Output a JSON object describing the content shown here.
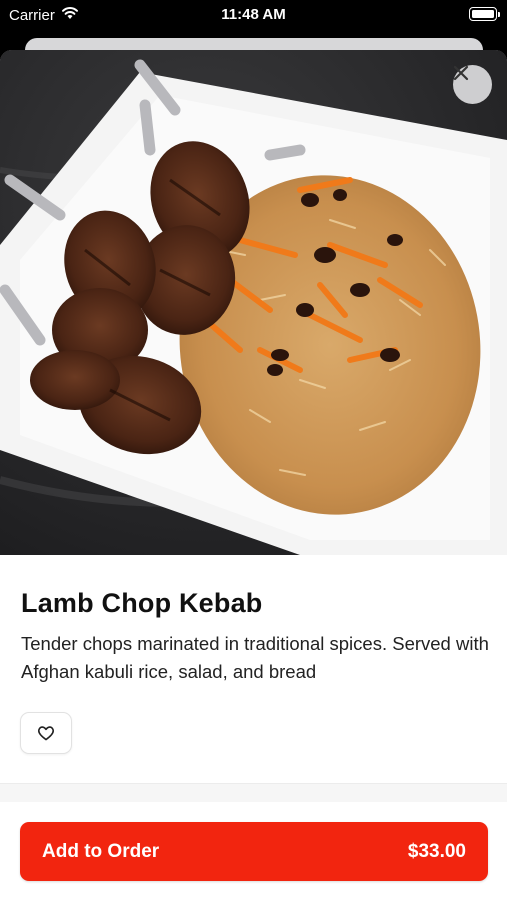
{
  "status_bar": {
    "carrier": "Carrier",
    "time": "11:48 AM",
    "wifi_icon": "wifi-icon",
    "battery_icon": "battery-icon"
  },
  "hero": {
    "image_subject": "lamb chops with kabuli rice on white plate",
    "close_icon": "close-icon"
  },
  "item": {
    "name": "Lamb Chop Kebab",
    "description": "Tender chops marinated in traditional spices. Served with Afghan kabuli rice, salad, and bread"
  },
  "actions": {
    "favorite_icon": "heart-icon",
    "add_label": "Add to Order",
    "price": "$33.00"
  },
  "colors": {
    "accent": "#f2250f",
    "background": "#ffffff",
    "text": "#111111"
  }
}
